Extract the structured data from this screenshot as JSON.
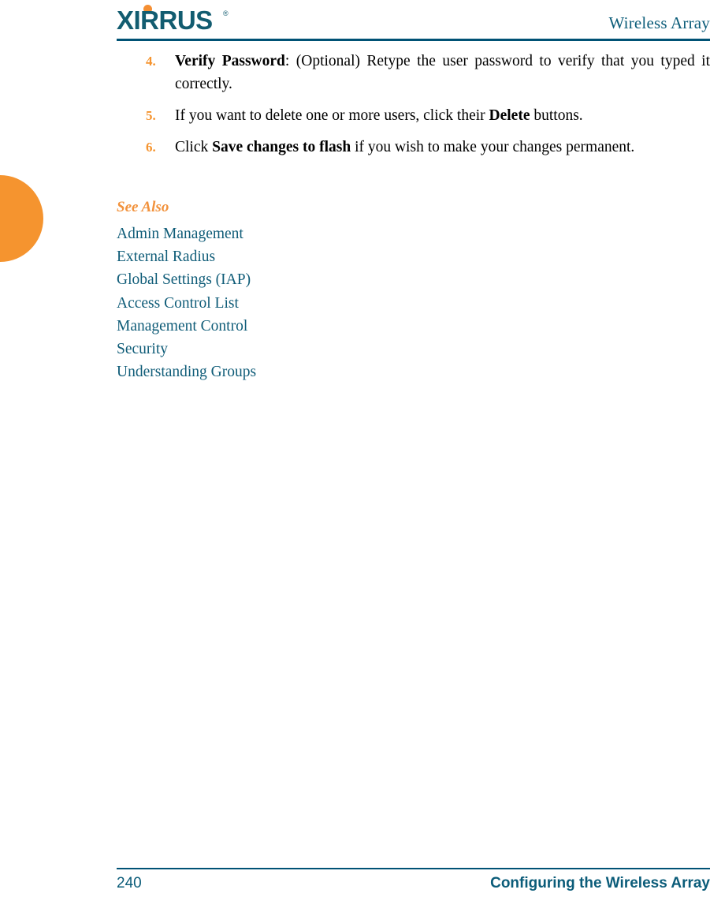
{
  "header": {
    "logo_text": "XIRRUS",
    "logo_registered": "®",
    "logo_dot_icon": "orange-dot-icon",
    "title": "Wireless Array"
  },
  "side_tab": {
    "icon": "orange-tab-icon",
    "color": "#F5942F"
  },
  "steps": [
    {
      "number": "4.",
      "bold_lead": "Verify Password",
      "text_after_lead": ": (Optional) Retype the user password to verify that you typed it correctly."
    },
    {
      "number": "5.",
      "text_before_bold": "If you want to delete one or more users, click their ",
      "bold_term": "Delete",
      "text_after_bold": " buttons."
    },
    {
      "number": "6.",
      "text_before_bold": "Click ",
      "bold_term": "Save changes to flash",
      "text_after_bold": " if you wish to make your changes permanent."
    }
  ],
  "see_also": {
    "heading": "See Also",
    "links": [
      "Admin Management",
      "External Radius",
      "Global Settings (IAP)",
      "Access Control List",
      "Management Control",
      "Security",
      "Understanding Groups"
    ]
  },
  "footer": {
    "page_number": "240",
    "section_title": "Configuring the Wireless Array"
  },
  "colors": {
    "teal": "#0B5C79",
    "rule": "#005275",
    "orange": "#F5942F",
    "see_also_orange": "#F2923C",
    "body_text": "#000000"
  }
}
